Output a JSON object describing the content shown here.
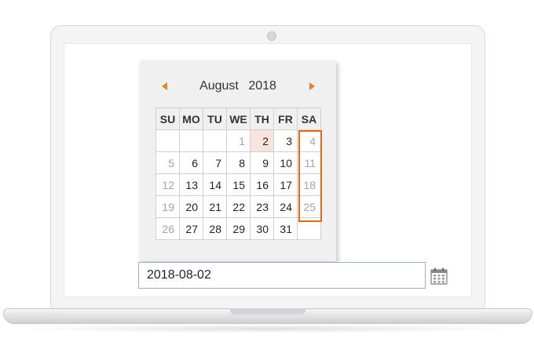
{
  "calendar": {
    "month": "August",
    "year": "2018",
    "weekdays": [
      "SU",
      "MO",
      "TU",
      "WE",
      "TH",
      "FR",
      "SA"
    ],
    "weeks": [
      [
        "",
        "",
        "",
        "1",
        "2",
        "3",
        "4"
      ],
      [
        "5",
        "6",
        "7",
        "8",
        "9",
        "10",
        "11"
      ],
      [
        "12",
        "13",
        "14",
        "15",
        "16",
        "17",
        "18"
      ],
      [
        "19",
        "20",
        "21",
        "22",
        "23",
        "24",
        "25"
      ],
      [
        "26",
        "27",
        "28",
        "29",
        "30",
        "31",
        ""
      ]
    ],
    "selected_day": "2",
    "muted_days": [
      "1",
      "4",
      "5",
      "11",
      "12",
      "18",
      "19",
      "25",
      "26"
    ],
    "highlighted_column": "SA"
  },
  "date_input": {
    "value": "2018-08-02"
  },
  "icons": {
    "prev": "chevron-left-icon",
    "next": "chevron-right-icon",
    "calendar": "calendar-icon"
  },
  "colors": {
    "accent": "#e8822a",
    "highlight_border": "#e06a12",
    "selected_bg": "#f8e4dc",
    "input_border": "#8fb5d8"
  }
}
